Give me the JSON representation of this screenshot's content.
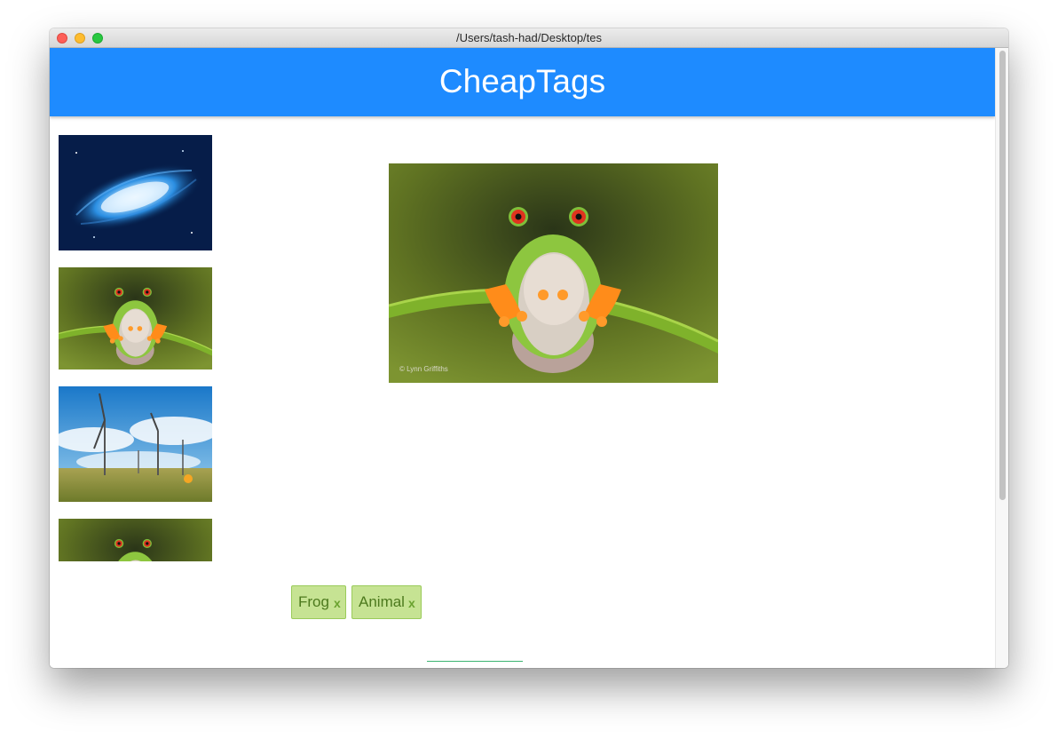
{
  "window": {
    "title": "/Users/tash-had/Desktop/tes"
  },
  "header": {
    "title": "CheapTags",
    "color": "#1e8bff"
  },
  "sidebar": {
    "thumbnails": [
      {
        "subject": "galaxy"
      },
      {
        "subject": "frog"
      },
      {
        "subject": "wind-turbines"
      },
      {
        "subject": "frog"
      }
    ]
  },
  "main": {
    "image": {
      "subject": "frog",
      "watermark": "© Lynn Griffiths"
    }
  },
  "tags": {
    "items": [
      {
        "label": "Frog",
        "remove": "x"
      },
      {
        "label": "Animal",
        "remove": "x"
      }
    ],
    "input_value": ""
  }
}
